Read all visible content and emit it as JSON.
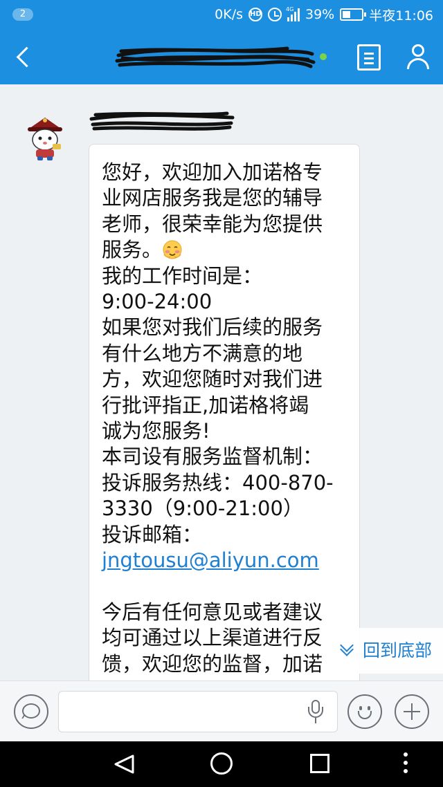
{
  "status_bar": {
    "notification_count": "2",
    "network_speed": "0K/s",
    "network_type": "4G",
    "battery_percent": "39%",
    "time": "半夜11:06"
  },
  "header": {
    "online_status_color": "#7bd34a"
  },
  "message": {
    "lines": [
      "您好，欢迎加入加诺格专",
      "业网店服务我是您的辅导",
      "老师，很荣幸能为您提供",
      "服务。",
      "我的工作时间是：",
      "9:00-24:00",
      "如果您对我们后续的服务",
      "有什么地方不满意的地",
      "方，欢迎您随时对我们进",
      "行批评指正,加诺格将竭",
      "诚为您服务!",
      "本司设有服务监督机制：",
      "投诉服务热线：400-870-",
      "3330（9:00-21:00）",
      "投诉邮箱：",
      "jngtousu@aliyun.com",
      "",
      "今后有任何意见或者建议",
      "均可通过以上渠道进行反",
      "馈，欢迎您的监督，加诺"
    ]
  },
  "back_to_bottom_label": "回到底部",
  "input": {
    "value": "",
    "placeholder": ""
  },
  "colors": {
    "brand_blue": "#1d8fe1",
    "link": "#1f7fd1"
  }
}
